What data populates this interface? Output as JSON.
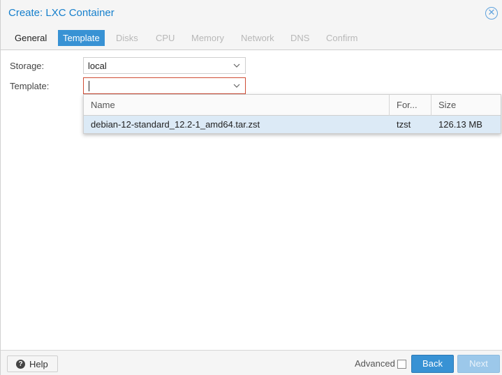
{
  "window": {
    "title": "Create: LXC Container",
    "close_icon": "close-circle-icon"
  },
  "tabs": [
    {
      "label": "General",
      "state": "enabled"
    },
    {
      "label": "Template",
      "state": "active"
    },
    {
      "label": "Disks",
      "state": "disabled"
    },
    {
      "label": "CPU",
      "state": "disabled"
    },
    {
      "label": "Memory",
      "state": "disabled"
    },
    {
      "label": "Network",
      "state": "disabled"
    },
    {
      "label": "DNS",
      "state": "disabled"
    },
    {
      "label": "Confirm",
      "state": "disabled"
    }
  ],
  "form": {
    "storage": {
      "label": "Storage:",
      "value": "local"
    },
    "template": {
      "label": "Template:",
      "value": ""
    }
  },
  "dropdown": {
    "columns": [
      "Name",
      "For...",
      "Size"
    ],
    "rows": [
      {
        "name": "debian-12-standard_12.2-1_amd64.tar.zst",
        "format": "tzst",
        "size": "126.13 MB"
      }
    ]
  },
  "footer": {
    "help_label": "Help",
    "advanced_label": "Advanced",
    "advanced_checked": false,
    "back_label": "Back",
    "next_label": "Next"
  },
  "colors": {
    "accent": "#3892d4",
    "title": "#157fcc",
    "selection": "#dceaf6",
    "invalid": "#cf4c35"
  }
}
